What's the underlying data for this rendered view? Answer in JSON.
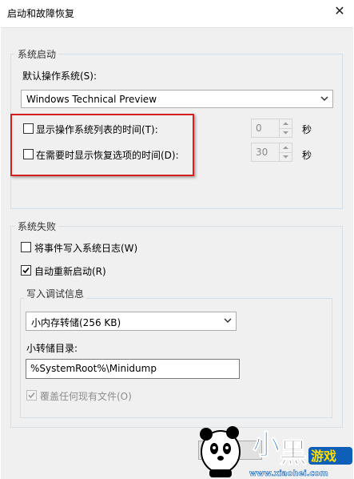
{
  "window": {
    "title": "启动和故障恢复",
    "close_icon": "close-icon"
  },
  "system_startup": {
    "legend": "系统启动",
    "default_os_label": "默认操作系统(S):",
    "default_os_value": "Windows Technical Preview",
    "show_os_list": {
      "label": "显示操作系统列表的时间(T):",
      "checked": false,
      "value": "0",
      "unit": "秒"
    },
    "show_recovery": {
      "label": "在需要时显示恢复选项的时间(D):",
      "checked": false,
      "value": "30",
      "unit": "秒"
    },
    "highlight_color": "#d81f1f"
  },
  "system_failure": {
    "legend": "系统失败",
    "write_event_log": {
      "label": "将事件写入系统日志(W)",
      "checked": false
    },
    "auto_restart": {
      "label": "自动重新启动(R)",
      "checked": true
    },
    "debug_info": {
      "legend": "写入调试信息",
      "dump_type": "小内存转储(256 KB)",
      "dump_dir_label": "小转储目录:",
      "dump_dir_value": "%SystemRoot%\\Minidump",
      "overwrite": {
        "label": "覆盖任何现有文件(O)",
        "checked": true,
        "disabled": true
      }
    }
  },
  "watermark": {
    "brand": "小黑游戏",
    "url": "www.xiaohei.com"
  }
}
